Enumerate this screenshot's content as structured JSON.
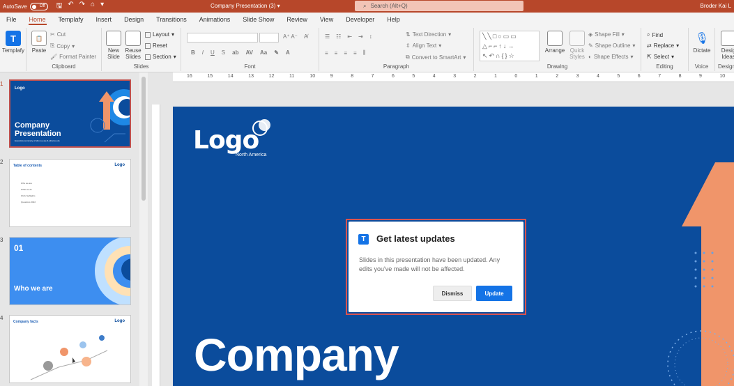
{
  "titlebar": {
    "autosave_label": "AutoSave",
    "autosave_state": "Off",
    "doc_title": "Company Presentation (3)",
    "search_placeholder": "Search (Alt+Q)",
    "user_name": "Broder Kai L"
  },
  "tabs": [
    "File",
    "Home",
    "Templafy",
    "Insert",
    "Design",
    "Transitions",
    "Animations",
    "Slide Show",
    "Review",
    "View",
    "Developer",
    "Help"
  ],
  "active_tab": "Home",
  "ribbon": {
    "templafy": {
      "label": "Templafy"
    },
    "clipboard": {
      "group": "Clipboard",
      "paste": "Paste",
      "cut": "Cut",
      "copy": "Copy",
      "format_painter": "Format Painter"
    },
    "slides": {
      "group": "Slides",
      "new_slide": "New Slide",
      "reuse_slides": "Reuse Slides",
      "layout": "Layout",
      "reset": "Reset",
      "section": "Section"
    },
    "font": {
      "group": "Font",
      "bold": "B",
      "italic": "I",
      "underline": "U",
      "strike": "S"
    },
    "paragraph": {
      "group": "Paragraph",
      "text_direction": "Text Direction",
      "align_text": "Align Text",
      "convert_smartart": "Convert to SmartArt"
    },
    "drawing": {
      "group": "Drawing",
      "arrange": "Arrange",
      "quick_styles": "Quick Styles",
      "shape_fill": "Shape Fill",
      "shape_outline": "Shape Outline",
      "shape_effects": "Shape Effects"
    },
    "editing": {
      "group": "Editing",
      "find": "Find",
      "replace": "Replace",
      "select": "Select"
    },
    "voice": {
      "group": "Voice",
      "dictate": "Dictate"
    },
    "designer": {
      "group": "Design",
      "design_ideas": "Desig Ideas"
    }
  },
  "slides_pane": {
    "thumbs": [
      {
        "num": "1",
        "title": "Company Presentation",
        "subtitle": "Executive summary of who we are & what we do",
        "logo": "Logo"
      },
      {
        "num": "2",
        "title": "Table of contents",
        "logo": "Logo",
        "items": [
          "Who we are",
          "What we do",
          "Work highlights",
          "Questions 2022"
        ]
      },
      {
        "num": "3",
        "title": "01",
        "subtitle": "Who we are"
      },
      {
        "num": "4",
        "title": "Company facts",
        "logo": "Logo"
      }
    ]
  },
  "ruler": {
    "ticks": [
      "16",
      "15",
      "14",
      "13",
      "12",
      "11",
      "10",
      "9",
      "8",
      "7",
      "6",
      "5",
      "4",
      "3",
      "2",
      "1",
      "0",
      "1",
      "2",
      "3",
      "4",
      "5",
      "6",
      "7",
      "8",
      "9",
      "10"
    ]
  },
  "slide": {
    "logo": "Logo",
    "logo_sub": "North America",
    "title": "Company"
  },
  "dialog": {
    "title": "Get latest updates",
    "body": "Slides in this presentation have been updated. Any edits you've made will not be affected.",
    "dismiss": "Dismiss",
    "update": "Update"
  },
  "colors": {
    "accent": "#b7472a",
    "slide_bg": "#0b4c9c",
    "templafy_blue": "#1473e6",
    "arrow_orange": "#f0956a",
    "highlight_red": "#d9534f"
  }
}
